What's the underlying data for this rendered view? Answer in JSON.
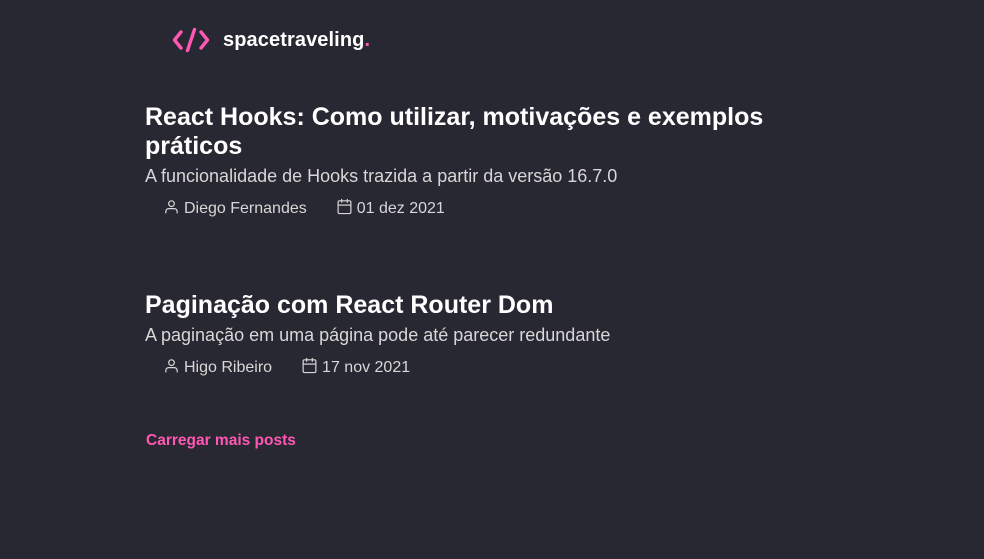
{
  "header": {
    "logo_icon": "code-brackets-icon",
    "logo_text": "spacetraveling",
    "logo_dot": "."
  },
  "posts": [
    {
      "title": "React Hooks: Como utilizar, motivações e exemplos práticos",
      "subtitle": "A funcionalidade de Hooks trazida a partir da versão 16.7.0",
      "author": "Diego Fernandes",
      "date": "01 dez 2021"
    },
    {
      "title": "Paginação com React Router Dom",
      "subtitle": "A paginação em uma página pode até parecer redundante",
      "author": "Higo Ribeiro",
      "date": "17 nov 2021"
    }
  ],
  "load_more_label": "Carregar mais posts",
  "colors": {
    "background": "#282833",
    "accent": "#ff57b2",
    "heading": "#ffffff",
    "body_text": "#d7d7d7"
  }
}
